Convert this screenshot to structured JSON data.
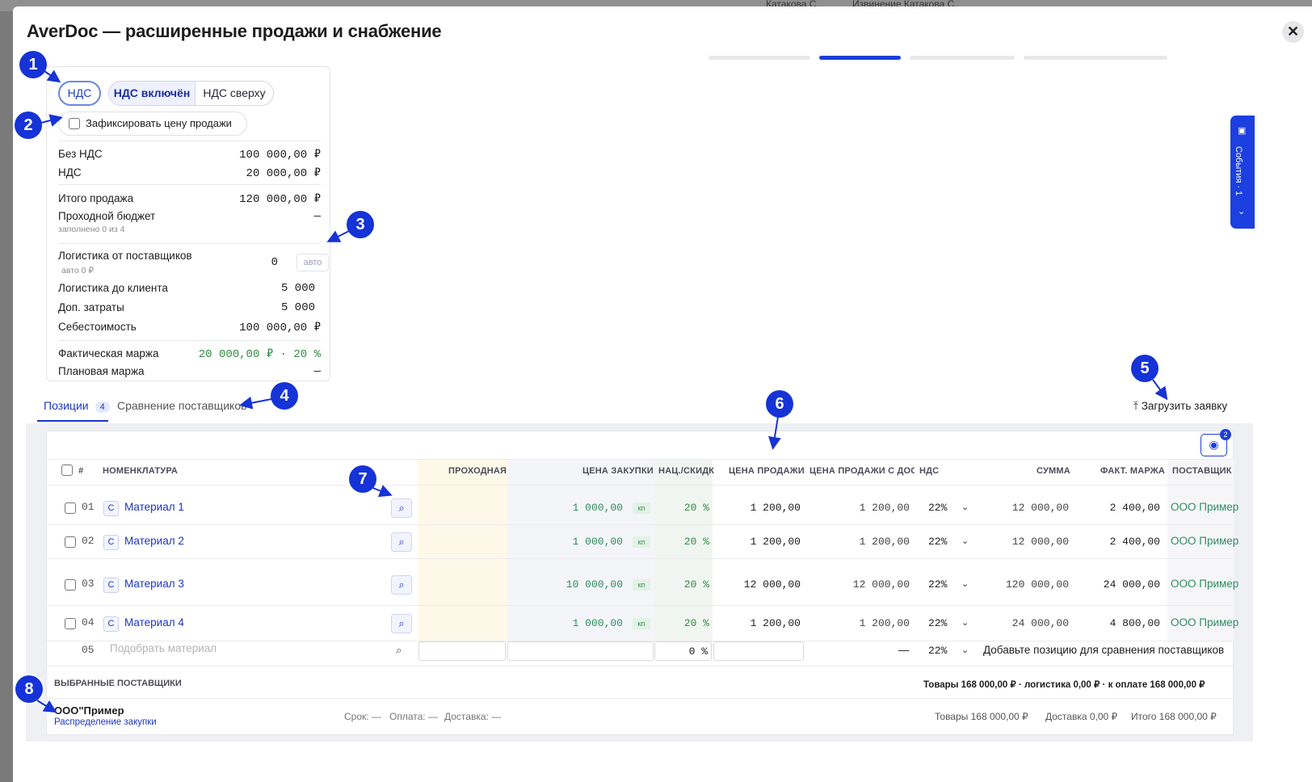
{
  "background": {
    "left_text": "Катакова С.",
    "right_text": "Извинение Катакова С."
  },
  "modal": {
    "title": "AverDoc — расширенные продажи и снабжение",
    "close_icon": "✕"
  },
  "events": {
    "label": "События · 1"
  },
  "vat": {
    "seg1": "НДС",
    "seg2": "НДС включён",
    "seg3": "НДС сверху",
    "fix_label": "Зафиксировать цену продажи"
  },
  "summary": {
    "no_vat_label": "Без НДС",
    "no_vat_value": "100 000,00 ₽",
    "vat_label": "НДС",
    "vat_value": "20 000,00 ₽",
    "total_label": "Итого продажа",
    "total_value": "120 000,00 ₽",
    "budget_label": "Проходной бюджет",
    "budget_value": "—",
    "budget_sub": "заполнено 0 из 4",
    "log_sup_label": "Логистика от поставщиков",
    "log_sup_value": "0",
    "log_sup_sub": "авто 0 ₽",
    "auto_btn": "авто",
    "log_cli_label": "Логистика до клиента",
    "log_cli_value": "5 000",
    "extra_label": "Доп. затраты",
    "extra_value": "5 000",
    "cost_label": "Себестоимость",
    "cost_value": "100 000,00 ₽",
    "fact_label": "Фактическая маржа",
    "fact_value": "20 000,00 ₽ · 20 %",
    "plan_label": "Плановая маржа",
    "plan_value": "—"
  },
  "tabs": {
    "positions": "Позиции",
    "positions_count": "4",
    "compare": "Сравнение поставщиков"
  },
  "upload": {
    "label": "Загрузить заявку",
    "icon": "upload-icon"
  },
  "eye": {
    "badge": "2"
  },
  "columns": {
    "num": "#",
    "name": "НОМЕНКЛАТУРА",
    "through": "ПРОХОДНАЯ",
    "buy": "ЦЕНА ЗАКУПКИ",
    "markup": "НАЦ./СКИДК",
    "sell": "ЦЕНА ПРОДАЖИ",
    "sell_deliv": "ЦЕНА ПРОДАЖИ С ДОСТ.",
    "vat": "НДС",
    "sum": "СУММА",
    "margin": "ФАКТ. МАРЖА",
    "supplier": "ПОСТАВЩИК"
  },
  "rows": [
    {
      "n": "01",
      "type": "С",
      "name": "Материал 1",
      "buy": "1 000,00",
      "kp": "кп",
      "markup": "20 %",
      "sell": "1 200,00",
      "sell_d": "1 200,00",
      "vat": "22%",
      "sum": "12 000,00",
      "margin": "2 400,00",
      "supplier": "ООО Пример"
    },
    {
      "n": "02",
      "type": "С",
      "name": "Материал 2",
      "buy": "1 000,00",
      "kp": "кп",
      "markup": "20 %",
      "sell": "1 200,00",
      "sell_d": "1 200,00",
      "vat": "22%",
      "sum": "12 000,00",
      "margin": "2 400,00",
      "supplier": "ООО Пример"
    },
    {
      "n": "03",
      "type": "С",
      "name": "Материал 3",
      "buy": "10 000,00",
      "kp": "кп",
      "markup": "20 %",
      "sell": "12 000,00",
      "sell_d": "12 000,00",
      "vat": "22%",
      "sum": "120 000,00",
      "margin": "24 000,00",
      "supplier": "ООО Пример"
    },
    {
      "n": "04",
      "type": "С",
      "name": "Материал 4",
      "buy": "1 000,00",
      "kp": "кп",
      "markup": "20 %",
      "sell": "1 200,00",
      "sell_d": "1 200,00",
      "vat": "22%",
      "sum": "24 000,00",
      "margin": "4 800,00",
      "supplier": "ООО Пример"
    }
  ],
  "new_row": {
    "n": "05",
    "placeholder": "Подобрать материал",
    "markup": "0 %",
    "sell_d": "—",
    "vat": "22%",
    "hint": "Добавьте позицию для сравнения поставщиков"
  },
  "footer": {
    "selected_title": "ВЫБРАННЫЕ ПОСТАВЩИКИ",
    "totals": "Товары 168 000,00 ₽ · логистика 0,00 ₽ · к оплате 168 000,00 ₽",
    "supplier_name": "ООО\"Пример",
    "distribution": "Распределение закупки",
    "term": "Срок: —",
    "payment": "Оплата: —",
    "delivery": "Доставка: —",
    "goods": "Товары 168 000,00 ₽",
    "deliv_sum": "Доставка 0,00 ₽",
    "total": "Итого 168 000,00 ₽"
  },
  "callouts": [
    "1",
    "2",
    "3",
    "4",
    "5",
    "6",
    "7",
    "8"
  ]
}
